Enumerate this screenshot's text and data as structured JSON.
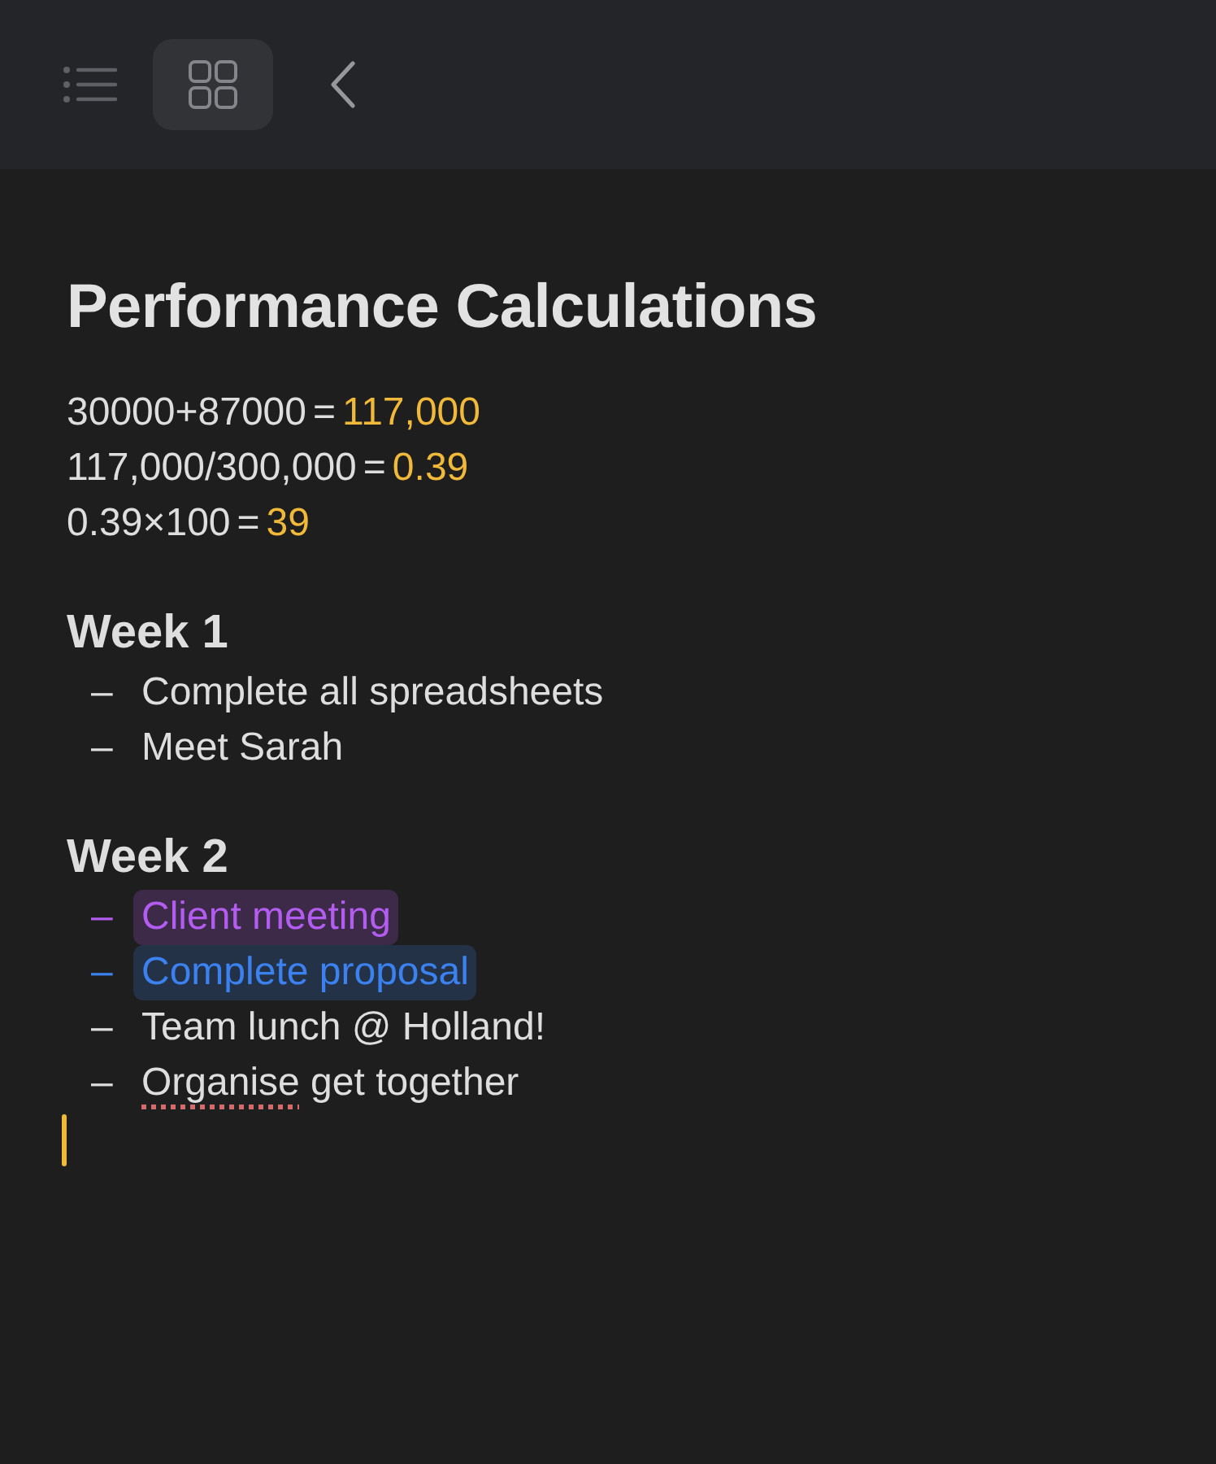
{
  "toolbar": {
    "view_buttons": [
      {
        "kind": "list",
        "selected": false
      },
      {
        "kind": "gallery",
        "selected": true
      }
    ],
    "back_button": {
      "kind": "back"
    }
  },
  "note": {
    "title": "Performance Calculations",
    "calculations": [
      {
        "expression": "30000+87000",
        "equals": "=",
        "result": "117,000"
      },
      {
        "expression": "117,000/300,000",
        "equals": "=",
        "result": "0.39"
      },
      {
        "expression": "0.39×100",
        "equals": "=",
        "result": "39"
      }
    ],
    "sections": [
      {
        "heading": "Week 1",
        "items": [
          {
            "kind": "plain",
            "bullet": "–",
            "text": "Complete all spreadsheets"
          },
          {
            "kind": "plain",
            "bullet": "–",
            "text": "Meet Sarah"
          }
        ]
      },
      {
        "heading": "Week 2",
        "items": [
          {
            "kind": "highlight",
            "bullet": "–",
            "text": "Client meeting",
            "color": "#b35cf0"
          },
          {
            "kind": "highlight",
            "bullet": "–",
            "text": "Complete proposal",
            "color": "#3b82f0"
          },
          {
            "kind": "plain",
            "bullet": "–",
            "text": "Team lunch @ Holland!"
          },
          {
            "kind": "misspelled",
            "bullet": "–",
            "flagged": "Organise",
            "text": " get together"
          }
        ]
      }
    ]
  }
}
